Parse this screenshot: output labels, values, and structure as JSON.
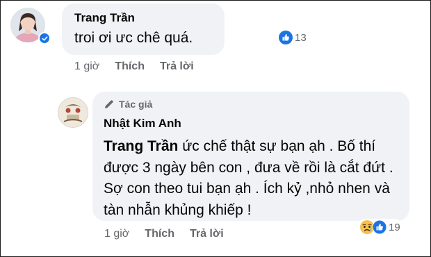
{
  "comment": {
    "author": "Trang Trần",
    "text": "troi ơi ưc chê quá.",
    "reaction_count": "13",
    "time": "1 giờ",
    "like_label": "Thích",
    "reply_label": "Trả lời"
  },
  "reply": {
    "author_badge": "Tác giả",
    "author": "Nhật Kim Anh",
    "mention": "Trang Trần",
    "text": " ức chế thật sự bạn ạh . Bố thí được 3 ngày bên con , đưa về rồi là cắt đứt . Sợ con theo tui bạn ạh . Ích kỷ ,nhỏ nhen và tàn nhẫn khủng khiếp !",
    "reaction_count": "19",
    "time": "1 giờ",
    "like_label": "Thích",
    "reply_label": "Trả lời"
  },
  "colors": {
    "like_blue": "#1b74e4",
    "bubble": "#f0f2f5",
    "muted": "#65676b",
    "sad_yellow": "#f7c14c"
  },
  "icons": [
    "verified-badge-icon",
    "like-reaction-icon",
    "sad-reaction-icon",
    "pencil-icon"
  ]
}
